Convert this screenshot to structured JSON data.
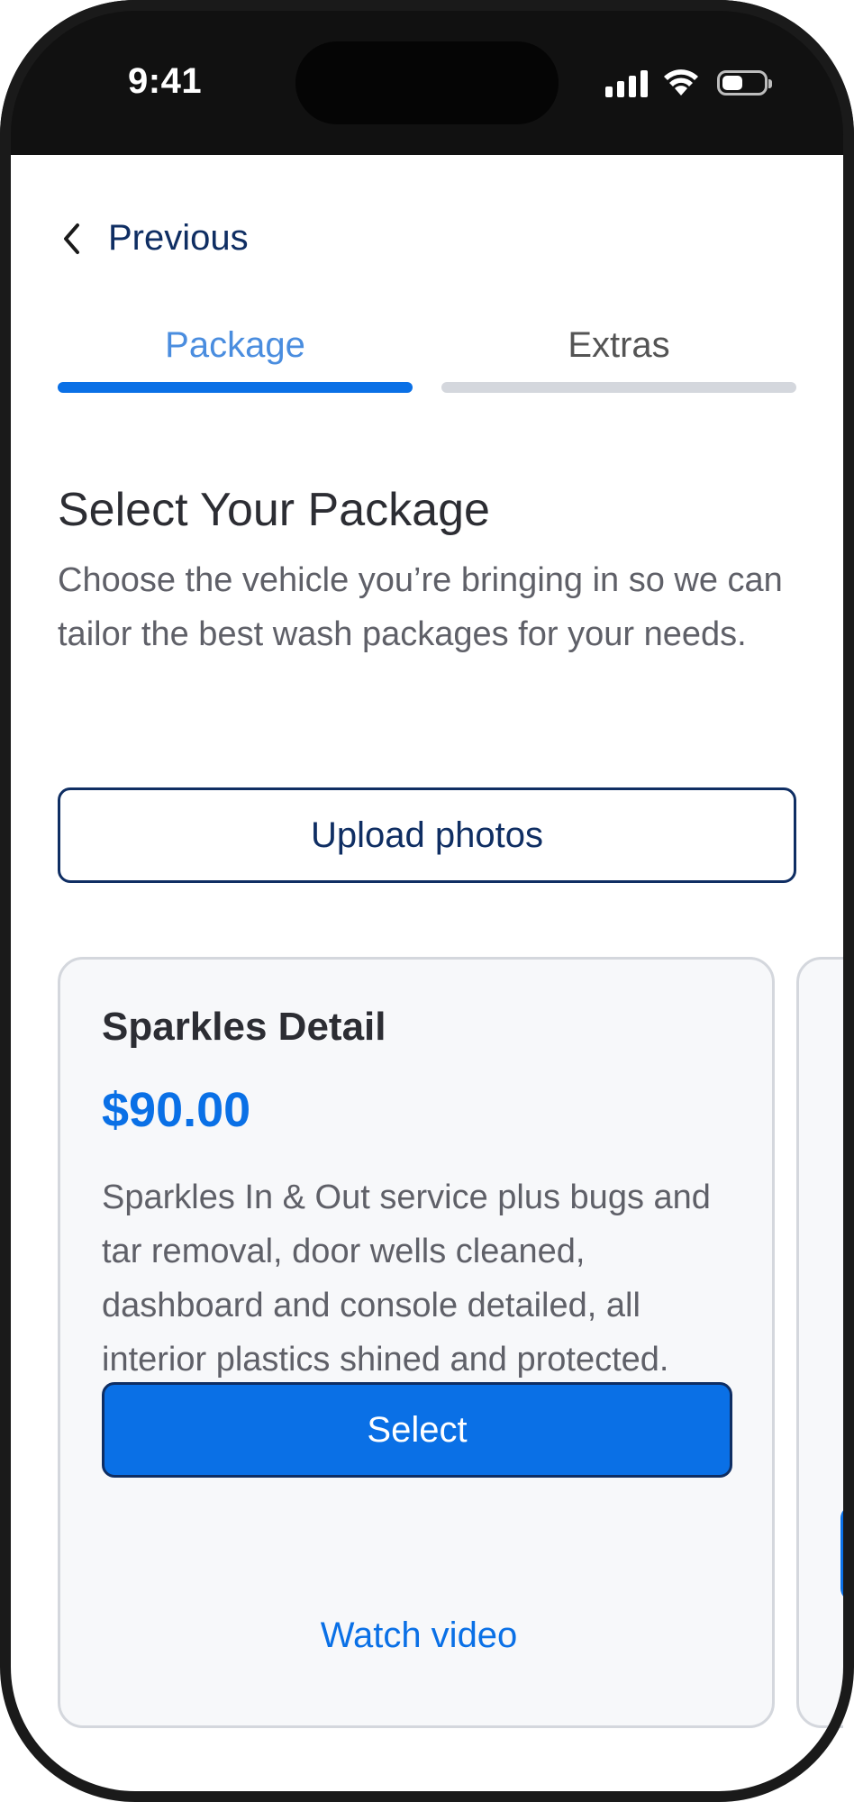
{
  "status_bar": {
    "time": "9:41",
    "icons": [
      "cellular-signal-icon",
      "wifi-icon",
      "battery-icon"
    ]
  },
  "nav": {
    "back_label": "Previous",
    "back_icon": "chevron-left-icon"
  },
  "tabs": [
    {
      "label": "Package",
      "active": true
    },
    {
      "label": "Extras",
      "active": false
    }
  ],
  "page": {
    "title": "Select Your Package",
    "subtitle": "Choose the vehicle you’re bringing in so we can tailor the best wash packages for your needs."
  },
  "upload_button": {
    "label": "Upload photos"
  },
  "packages": [
    {
      "name": "Sparkles Detail",
      "price": "$90.00",
      "description": "Sparkles In & Out service plus bugs and tar removal, door wells cleaned, dashboard and console detailed, all interior plastics shined and protected.",
      "select_label": "Select",
      "video_label": "Watch video"
    }
  ],
  "colors": {
    "accent": "#0a70e6",
    "navy": "#0f2e63",
    "tab_active_text": "#4a8ddf",
    "tab_inactive_bar": "#d4d7dd",
    "card_bg": "#f7f8fa"
  }
}
